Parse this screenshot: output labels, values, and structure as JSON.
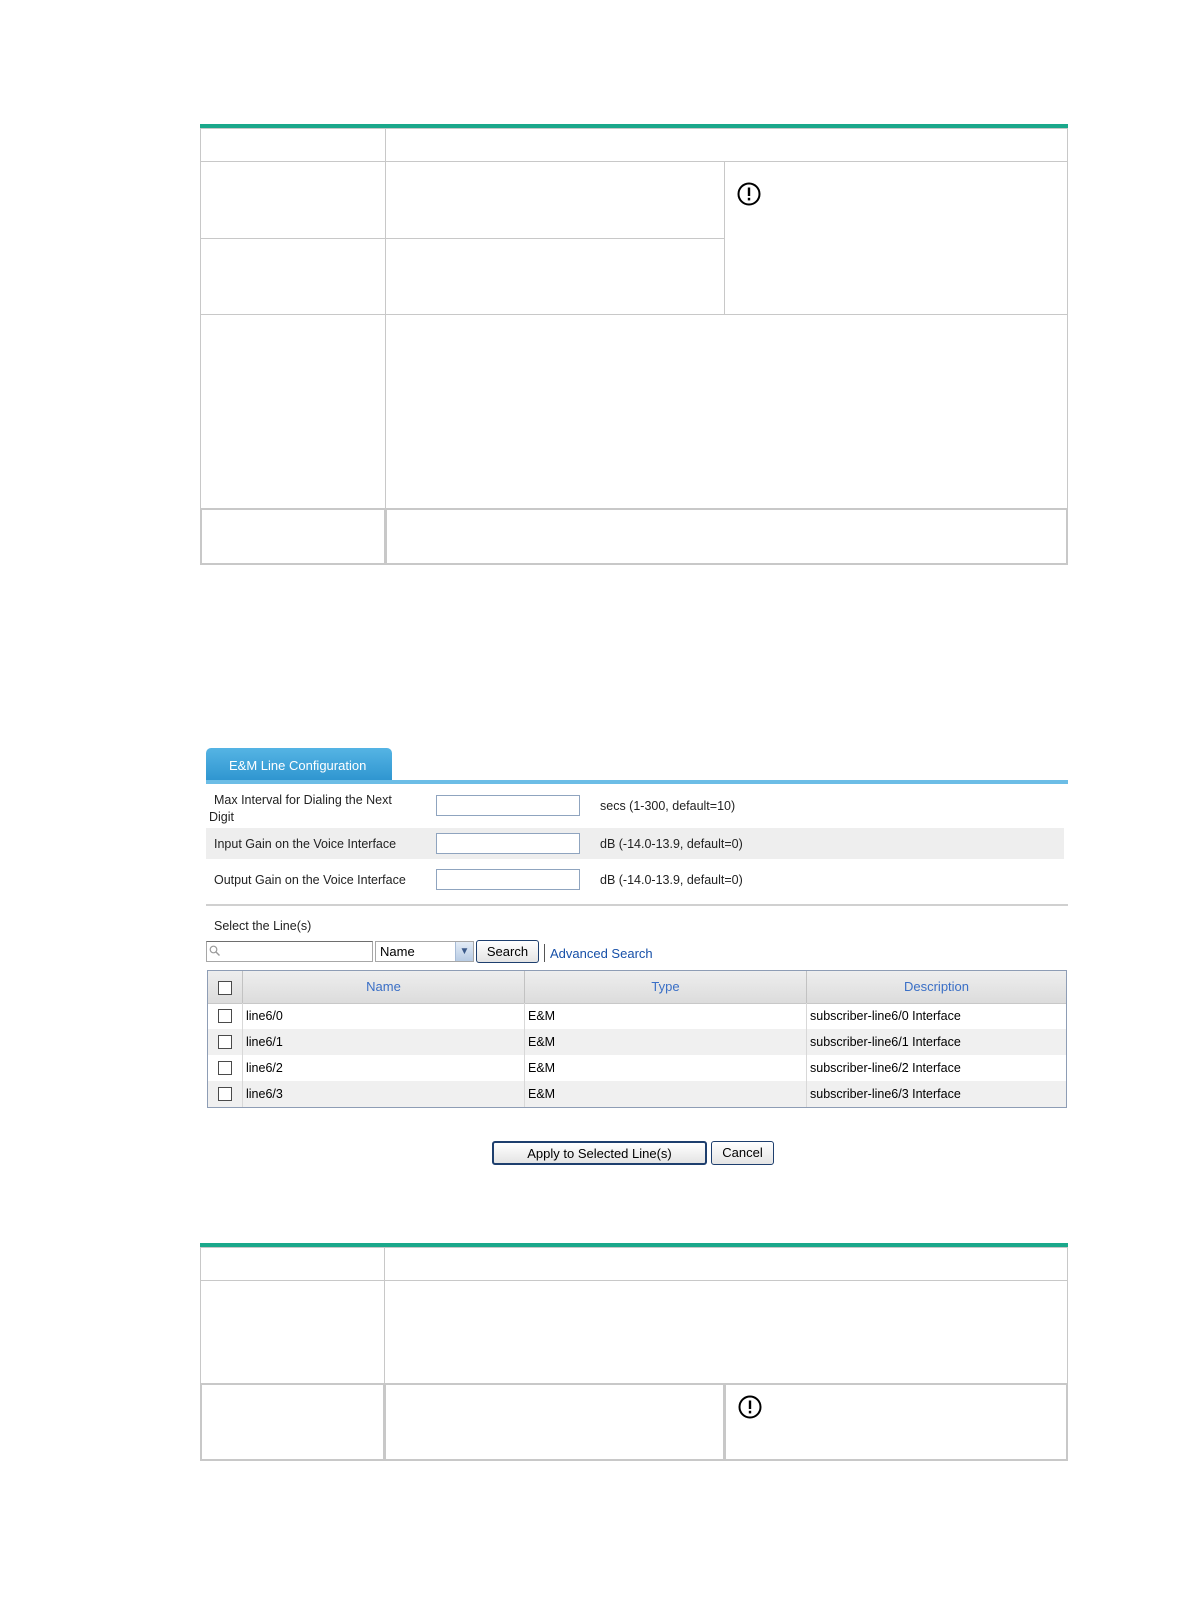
{
  "form": {
    "tab_title": "E&M Line Configuration",
    "fields": [
      {
        "label_line1": "Max Interval for Dialing the Next",
        "label_line2": "Digit",
        "value": "",
        "hint": "secs (1-300, default=10)"
      },
      {
        "label": "Input Gain on the Voice Interface",
        "value": "",
        "hint": "dB (-14.0-13.9, default=0)"
      },
      {
        "label": "Output Gain on the Voice Interface",
        "value": "",
        "hint": "dB (-14.0-13.9, default=0)"
      }
    ],
    "select_lines_label": "Select the Line(s)",
    "search": {
      "value": "",
      "field_selected": "Name",
      "search_button": "Search",
      "advanced_link": "Advanced Search"
    },
    "grid": {
      "columns": [
        "Name",
        "Type",
        "Description"
      ],
      "rows": [
        {
          "name": "line6/0",
          "type": "E&M",
          "description": "subscriber-line6/0 Interface"
        },
        {
          "name": "line6/1",
          "type": "E&M",
          "description": "subscriber-line6/1 Interface"
        },
        {
          "name": "line6/2",
          "type": "E&M",
          "description": "subscriber-line6/2 Interface"
        },
        {
          "name": "line6/3",
          "type": "E&M",
          "description": "subscriber-line6/3 Interface"
        }
      ]
    },
    "buttons": {
      "apply": "Apply to Selected Line(s)",
      "cancel": "Cancel"
    }
  },
  "icons": {
    "warning": "caution-circle-icon",
    "search": "search-icon",
    "dropdown": "chevron-down-icon"
  },
  "colors": {
    "table_accent": "#1aa88b",
    "tab_blue": "#2d94cf",
    "link_blue": "#1750a8",
    "header_text": "#3a6fc6"
  }
}
